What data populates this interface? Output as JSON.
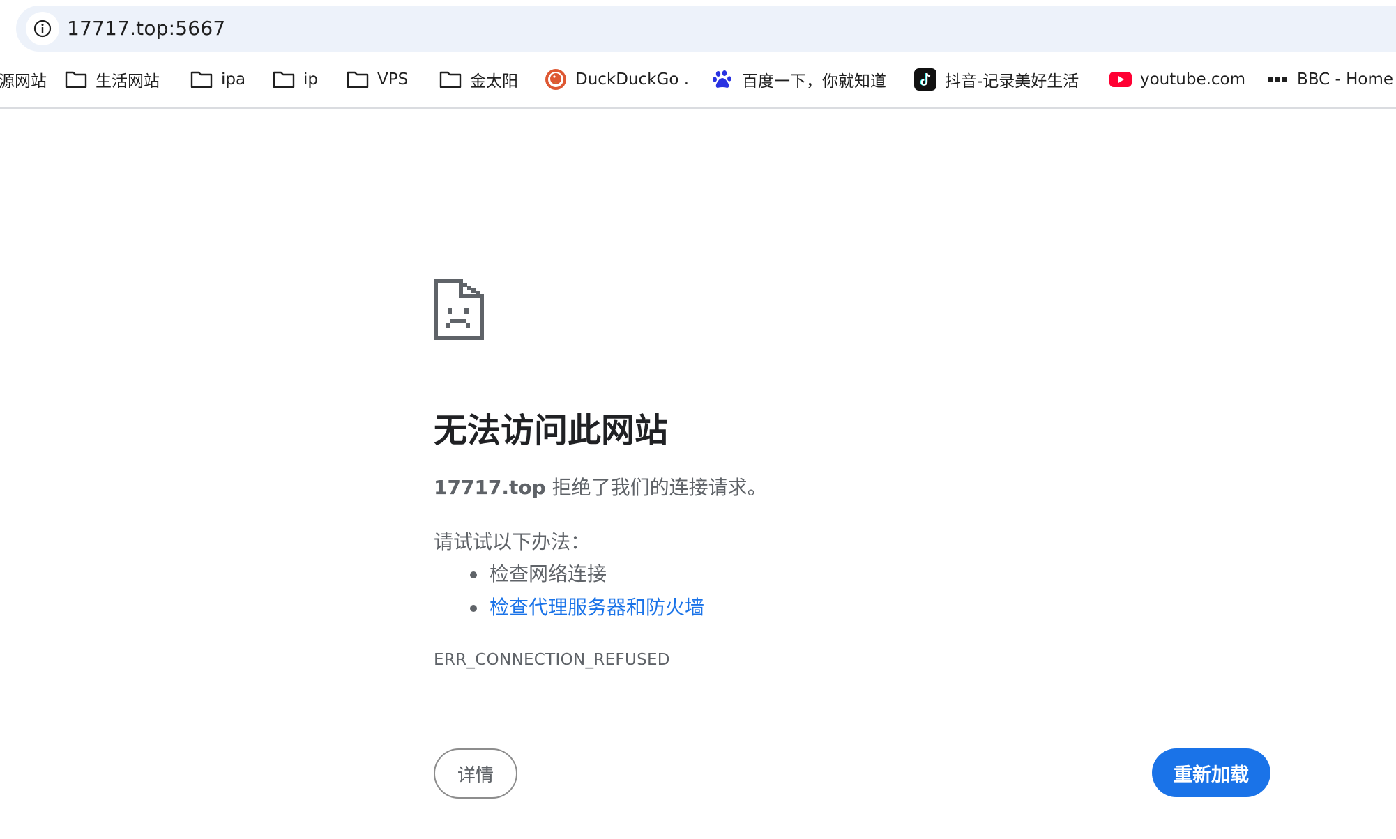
{
  "address_bar": {
    "url": "17717.top:5667",
    "icon": "info-icon"
  },
  "bookmarks": [
    {
      "label": "源网站",
      "icon": "none"
    },
    {
      "label": "生活网站",
      "icon": "folder-icon"
    },
    {
      "label": "ipa",
      "icon": "folder-icon"
    },
    {
      "label": "ip",
      "icon": "folder-icon"
    },
    {
      "label": "VPS",
      "icon": "folder-icon"
    },
    {
      "label": "金太阳",
      "icon": "folder-icon"
    },
    {
      "label": "DuckDuckGo .",
      "icon": "duckduckgo-icon"
    },
    {
      "label": "百度一下，你就知道",
      "icon": "baidu-paw-icon"
    },
    {
      "label": "抖音-记录美好生活",
      "icon": "tiktok-icon"
    },
    {
      "label": "youtube.com",
      "icon": "youtube-icon"
    },
    {
      "label": "BBC - Home",
      "icon": "bbc-icon"
    }
  ],
  "error": {
    "icon": "sad-document-icon",
    "title": "无法访问此网站",
    "host": "17717.top",
    "summary_rest": " 拒绝了我们的连接请求。",
    "suggestions_heading": "请试试以下办法：",
    "suggestions": [
      {
        "text": "检查网络连接",
        "is_link": false
      },
      {
        "text": "检查代理服务器和防火墙",
        "is_link": true
      }
    ],
    "code": "ERR_CONNECTION_REFUSED"
  },
  "buttons": {
    "details": "详情",
    "reload": "重新加载"
  },
  "colors": {
    "omnibox_bg": "#edf2fa",
    "link": "#1a73e8",
    "primary_button": "#1a73e8",
    "muted_text": "#5f6368"
  }
}
